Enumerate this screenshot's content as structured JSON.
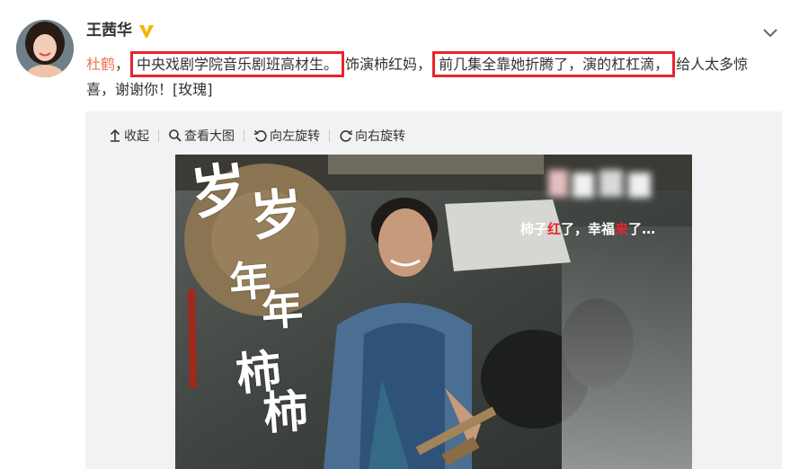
{
  "post": {
    "username": "王茜华",
    "mention": "杜鹤",
    "text_part1": "，",
    "highlight1": "中央戏剧学院音乐剧班高材生。",
    "text_part2": "饰演柿红妈，",
    "highlight2": "前几集全靠她折腾了，演的杠杠滴，",
    "text_part3": "给人太多惊喜，谢谢你！[玫瑰]"
  },
  "toolbar": {
    "collapse_label": "收起",
    "view_large_label": "查看大图",
    "rotate_left_label": "向左旋转",
    "rotate_right_label": "向右旋转"
  },
  "image": {
    "title_line1_a": "岁",
    "title_line1_b": "岁",
    "title_line2_a": "年",
    "title_line2_b": "年",
    "title_line3_a": "柿",
    "title_line3_b": "柿",
    "tagline_a": "柿子",
    "tagline_red1": "红",
    "tagline_b": "了，幸福",
    "tagline_red2": "来",
    "tagline_c": "了…"
  },
  "icons": {
    "verified": "verified-v-icon",
    "chevron": "chevron-down-icon",
    "collapse": "arrow-up-icon",
    "view_large": "magnifier-icon",
    "rotate_left": "rotate-left-icon",
    "rotate_right": "rotate-right-icon"
  },
  "colors": {
    "mention": "#eb7350",
    "highlight_border": "#e8242c",
    "verified": "#f7b500",
    "panel_bg": "#f2f2f5"
  }
}
